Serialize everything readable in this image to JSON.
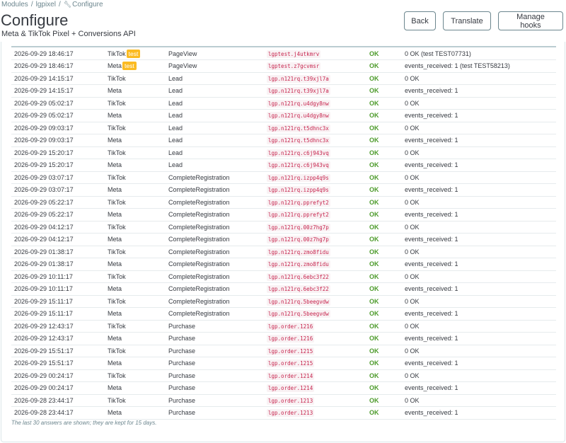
{
  "breadcrumb": {
    "modules": "Modules",
    "module": "lgpixel",
    "current": "Configure"
  },
  "page": {
    "title": "Configure",
    "subtitle": "Meta & TikTok Pixel + Conversions API"
  },
  "toolbar": {
    "back": "Back",
    "translate": "Translate",
    "manage_hooks": "Manage hooks"
  },
  "rows": [
    {
      "date": "2026-09-29 18:46:17",
      "platform": "TikTok",
      "badge": "test",
      "event": "PageView",
      "event_id": "lgptest.j4utkmrv",
      "status": "OK",
      "response": "0 OK (test TEST07731)"
    },
    {
      "date": "2026-09-29 18:46:17",
      "platform": "Meta",
      "badge": "test",
      "event": "PageView",
      "event_id": "lgptest.z7gcvmsr",
      "status": "OK",
      "response": "events_received: 1 (test TEST58213)"
    },
    {
      "date": "2026-09-29 14:15:17",
      "platform": "TikTok",
      "badge": "",
      "event": "Lead",
      "event_id": "lgp.n121rq.t39xjl7a",
      "status": "OK",
      "response": "0 OK"
    },
    {
      "date": "2026-09-29 14:15:17",
      "platform": "Meta",
      "badge": "",
      "event": "Lead",
      "event_id": "lgp.n121rq.t39xjl7a",
      "status": "OK",
      "response": "events_received: 1"
    },
    {
      "date": "2026-09-29 05:02:17",
      "platform": "TikTok",
      "badge": "",
      "event": "Lead",
      "event_id": "lgp.n121rq.u4dgy8nw",
      "status": "OK",
      "response": "0 OK"
    },
    {
      "date": "2026-09-29 05:02:17",
      "platform": "Meta",
      "badge": "",
      "event": "Lead",
      "event_id": "lgp.n121rq.u4dgy8nw",
      "status": "OK",
      "response": "events_received: 1"
    },
    {
      "date": "2026-09-29 09:03:17",
      "platform": "TikTok",
      "badge": "",
      "event": "Lead",
      "event_id": "lgp.n121rq.t5dhnc3x",
      "status": "OK",
      "response": "0 OK"
    },
    {
      "date": "2026-09-29 09:03:17",
      "platform": "Meta",
      "badge": "",
      "event": "Lead",
      "event_id": "lgp.n121rq.t5dhnc3x",
      "status": "OK",
      "response": "events_received: 1"
    },
    {
      "date": "2026-09-29 15:20:17",
      "platform": "TikTok",
      "badge": "",
      "event": "Lead",
      "event_id": "lgp.n121rq.c6j943vq",
      "status": "OK",
      "response": "0 OK"
    },
    {
      "date": "2026-09-29 15:20:17",
      "platform": "Meta",
      "badge": "",
      "event": "Lead",
      "event_id": "lgp.n121rq.c6j943vq",
      "status": "OK",
      "response": "events_received: 1"
    },
    {
      "date": "2026-09-29 03:07:17",
      "platform": "TikTok",
      "badge": "",
      "event": "CompleteRegistration",
      "event_id": "lgp.n121rq.izpp4q9s",
      "status": "OK",
      "response": "0 OK"
    },
    {
      "date": "2026-09-29 03:07:17",
      "platform": "Meta",
      "badge": "",
      "event": "CompleteRegistration",
      "event_id": "lgp.n121rq.izpp4q9s",
      "status": "OK",
      "response": "events_received: 1"
    },
    {
      "date": "2026-09-29 05:22:17",
      "platform": "TikTok",
      "badge": "",
      "event": "CompleteRegistration",
      "event_id": "lgp.n121rq.pprefyt2",
      "status": "OK",
      "response": "0 OK"
    },
    {
      "date": "2026-09-29 05:22:17",
      "platform": "Meta",
      "badge": "",
      "event": "CompleteRegistration",
      "event_id": "lgp.n121rq.pprefyt2",
      "status": "OK",
      "response": "events_received: 1"
    },
    {
      "date": "2026-09-29 04:12:17",
      "platform": "TikTok",
      "badge": "",
      "event": "CompleteRegistration",
      "event_id": "lgp.n121rq.00z7hg7p",
      "status": "OK",
      "response": "0 OK"
    },
    {
      "date": "2026-09-29 04:12:17",
      "platform": "Meta",
      "badge": "",
      "event": "CompleteRegistration",
      "event_id": "lgp.n121rq.00z7hg7p",
      "status": "OK",
      "response": "events_received: 1"
    },
    {
      "date": "2026-09-29 01:38:17",
      "platform": "TikTok",
      "badge": "",
      "event": "CompleteRegistration",
      "event_id": "lgp.n121rq.zmo8fidu",
      "status": "OK",
      "response": "0 OK"
    },
    {
      "date": "2026-09-29 01:38:17",
      "platform": "Meta",
      "badge": "",
      "event": "CompleteRegistration",
      "event_id": "lgp.n121rq.zmo8fidu",
      "status": "OK",
      "response": "events_received: 1"
    },
    {
      "date": "2026-09-29 10:11:17",
      "platform": "TikTok",
      "badge": "",
      "event": "CompleteRegistration",
      "event_id": "lgp.n121rq.6ebc3f22",
      "status": "OK",
      "response": "0 OK"
    },
    {
      "date": "2026-09-29 10:11:17",
      "platform": "Meta",
      "badge": "",
      "event": "CompleteRegistration",
      "event_id": "lgp.n121rq.6ebc3f22",
      "status": "OK",
      "response": "events_received: 1"
    },
    {
      "date": "2026-09-29 15:11:17",
      "platform": "TikTok",
      "badge": "",
      "event": "CompleteRegistration",
      "event_id": "lgp.n121rq.5beegvdw",
      "status": "OK",
      "response": "0 OK"
    },
    {
      "date": "2026-09-29 15:11:17",
      "platform": "Meta",
      "badge": "",
      "event": "CompleteRegistration",
      "event_id": "lgp.n121rq.5beegvdw",
      "status": "OK",
      "response": "events_received: 1"
    },
    {
      "date": "2026-09-29 12:43:17",
      "platform": "TikTok",
      "badge": "",
      "event": "Purchase",
      "event_id": "lgp.order.1216",
      "status": "OK",
      "response": "0 OK"
    },
    {
      "date": "2026-09-29 12:43:17",
      "platform": "Meta",
      "badge": "",
      "event": "Purchase",
      "event_id": "lgp.order.1216",
      "status": "OK",
      "response": "events_received: 1"
    },
    {
      "date": "2026-09-29 15:51:17",
      "platform": "TikTok",
      "badge": "",
      "event": "Purchase",
      "event_id": "lgp.order.1215",
      "status": "OK",
      "response": "0 OK"
    },
    {
      "date": "2026-09-29 15:51:17",
      "platform": "Meta",
      "badge": "",
      "event": "Purchase",
      "event_id": "lgp.order.1215",
      "status": "OK",
      "response": "events_received: 1"
    },
    {
      "date": "2026-09-29 00:24:17",
      "platform": "TikTok",
      "badge": "",
      "event": "Purchase",
      "event_id": "lgp.order.1214",
      "status": "OK",
      "response": "0 OK"
    },
    {
      "date": "2026-09-29 00:24:17",
      "platform": "Meta",
      "badge": "",
      "event": "Purchase",
      "event_id": "lgp.order.1214",
      "status": "OK",
      "response": "events_received: 1"
    },
    {
      "date": "2026-09-28 23:44:17",
      "platform": "TikTok",
      "badge": "",
      "event": "Purchase",
      "event_id": "lgp.order.1213",
      "status": "OK",
      "response": "0 OK"
    },
    {
      "date": "2026-09-28 23:44:17",
      "platform": "Meta",
      "badge": "",
      "event": "Purchase",
      "event_id": "lgp.order.1213",
      "status": "OK",
      "response": "events_received: 1"
    }
  ],
  "footnote": "The last 30 answers are shown; they are kept for 15 days.",
  "colors": {
    "ok": "#4c9a2a",
    "badge": "#fbbb22",
    "event_id_text": "#c7254e",
    "event_id_bg": "#f9f2f4"
  },
  "icons": {
    "breadcrumb_current": "wrench-icon"
  }
}
